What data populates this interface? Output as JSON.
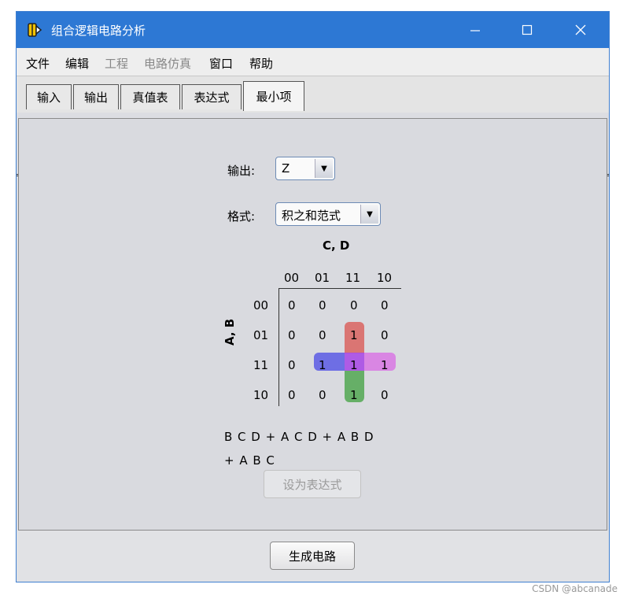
{
  "window": {
    "title": "组合逻辑电路分析",
    "controls": {
      "minimize": "minimize-icon",
      "maximize": "maximize-icon",
      "close": "close-icon"
    }
  },
  "menu": [
    {
      "label": "文件",
      "enabled": true
    },
    {
      "label": "编辑",
      "enabled": true
    },
    {
      "label": "工程",
      "enabled": false
    },
    {
      "label": "电路仿真",
      "enabled": false
    },
    {
      "label": "窗口",
      "enabled": true
    },
    {
      "label": "帮助",
      "enabled": true
    }
  ],
  "tabs": [
    "输入",
    "输出",
    "真值表",
    "表达式",
    "最小项"
  ],
  "active_tab": "最小项",
  "output": {
    "label": "输出:",
    "value": "Z"
  },
  "format": {
    "label": "格式:",
    "value": "积之和范式"
  },
  "kmap": {
    "col_var_label": "C, D",
    "row_var_label": "A, B",
    "col_headers": [
      "00",
      "01",
      "11",
      "10"
    ],
    "row_headers": [
      "00",
      "01",
      "11",
      "10"
    ],
    "cells": [
      [
        "0",
        "0",
        "0",
        "0"
      ],
      [
        "0",
        "0",
        "1",
        "0"
      ],
      [
        "0",
        "1",
        "1",
        "1"
      ],
      [
        "0",
        "0",
        "1",
        "0"
      ]
    ],
    "groups": [
      {
        "color": "#d9534f"
      },
      {
        "color": "#4a4ae6"
      },
      {
        "color": "#d94fe6"
      },
      {
        "color": "#3fa03f"
      }
    ]
  },
  "expression": {
    "line1": "B C D + A C D + A B D",
    "line2": "+ A B C"
  },
  "set_expression_button": "设为表达式",
  "build_circuit_button": "生成电路",
  "watermark": "CSDN @abcanade"
}
